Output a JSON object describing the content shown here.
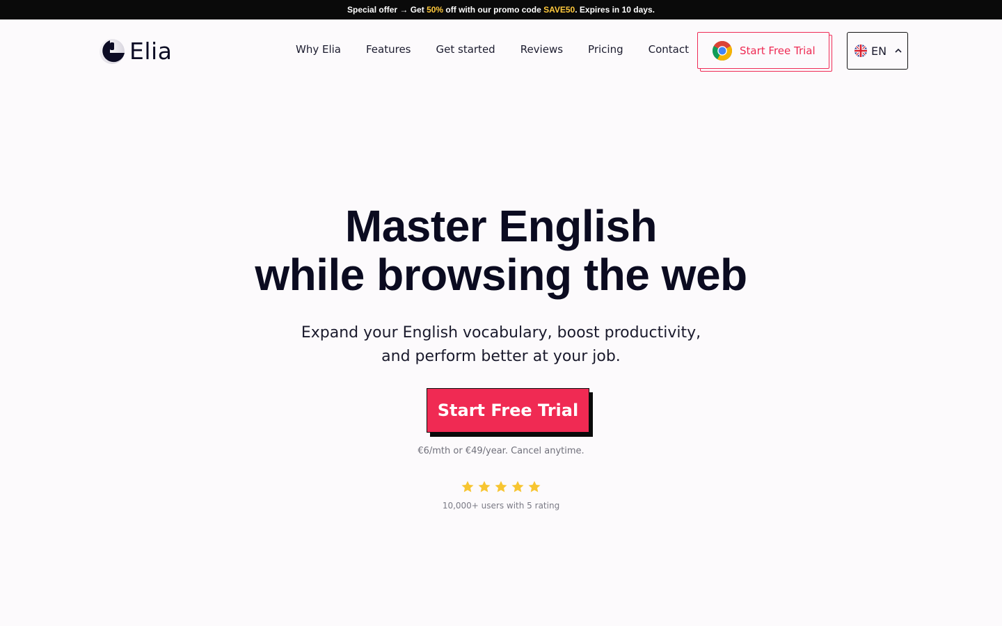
{
  "promo": {
    "prefix": "Special offer → Get ",
    "discount": "50%",
    "middle": " off with our promo code ",
    "code": "SAVE50",
    "suffix": ". Expires in 10 days."
  },
  "brand": {
    "name": "Elia"
  },
  "nav": {
    "items": [
      {
        "label": "Why Elia"
      },
      {
        "label": "Features"
      },
      {
        "label": "Get started"
      },
      {
        "label": "Reviews"
      },
      {
        "label": "Pricing"
      },
      {
        "label": "Contact"
      }
    ]
  },
  "header": {
    "trial_label": "Start Free Trial",
    "trial_icon": "chrome-icon",
    "lang_label": "EN",
    "lang_icon": "uk-flag-icon"
  },
  "hero": {
    "title_line1": "Master English",
    "title_line2": "while browsing the web",
    "subtitle_line1": "Expand your English vocabulary, boost productivity,",
    "subtitle_line2": "and perform better at your job.",
    "cta_label": "Start Free Trial",
    "price_note": "€6/mth or €49/year. Cancel anytime.",
    "rating_stars": 5,
    "rating_note": "10,000+ users with 5 rating"
  },
  "colors": {
    "accent": "#f02a53",
    "promo_highlight": "#ffc93c",
    "star": "#f7c531",
    "background": "#fcfafc"
  }
}
